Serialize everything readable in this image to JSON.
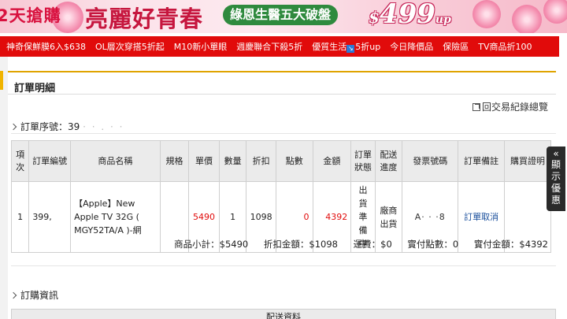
{
  "banner": {
    "days_text": "2天搶購",
    "slogan": "亮麗好青春",
    "pill": "綠恩生醫五大破盤",
    "price_currency": "$",
    "price_value": "499",
    "price_suffix": "up"
  },
  "nav": {
    "items": [
      "神奇保鮮膜6入$638",
      "OL層次穿搭5折起",
      "M10新小單眼",
      "週慶聯合下殺5折",
      "優質生活",
      "5折up",
      "今日降價品",
      "保險區",
      "TV商品折100"
    ]
  },
  "page": {
    "title": "訂單明細",
    "history_link": "回交易紀錄總覽",
    "order_no_label": "訂單序號：39",
    "order_no_masked": "·  ·  .  ·  ·"
  },
  "table": {
    "headers": [
      "項次",
      "訂單編號",
      "商品名稱",
      "規格",
      "單價",
      "數量",
      "折扣",
      "點數",
      "金額",
      "訂單狀態",
      "配送進度",
      "發票號碼",
      "訂單備註",
      "購買證明"
    ],
    "row": {
      "index": "1",
      "order_id": "399,",
      "product": "【Apple】New Apple TV 32G ( MGY52TA/A )-網",
      "spec": "",
      "unit_price": "5490",
      "qty": "1",
      "discount": "1098",
      "points": "0",
      "amount": "4392",
      "status": "出貨準備中",
      "delivery": "廠商出貨",
      "invoice": "A·  ·  ·8",
      "remark": "訂單取消",
      "proof": ""
    }
  },
  "totals": {
    "subtotal": "商品小計：$5490",
    "discount_total": "折扣金額：$1098",
    "shipping": "運費：$0",
    "points_paid": "實付點數：0",
    "amount_paid": "實付金額：$4392"
  },
  "sections": {
    "purchase_info": "訂購資訊",
    "delivery_info": "配送資料"
  },
  "side_tab": {
    "label": "顯示優惠"
  },
  "colors": {
    "nav_red": "#e10b0b",
    "accent_gold": "#e0a400",
    "link_blue": "#1a4f9c"
  }
}
